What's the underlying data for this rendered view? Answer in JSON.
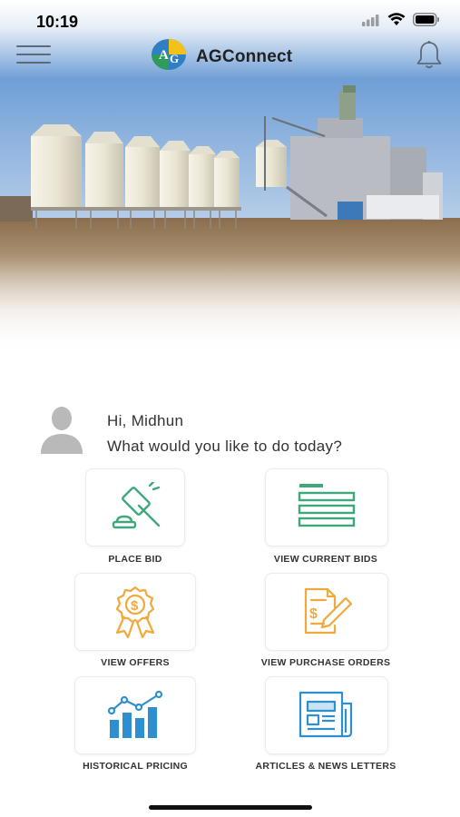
{
  "status": {
    "time": "10:19"
  },
  "header": {
    "app_title": "AGConnect",
    "logo_letters": "AG"
  },
  "greeting": {
    "hello": "Hi, Midhun",
    "prompt": "What would you like to do today?"
  },
  "actions": [
    {
      "label": "PLACE BID",
      "icon": "gavel-icon"
    },
    {
      "label": "VIEW CURRENT BIDS",
      "icon": "list-icon"
    },
    {
      "label": "VIEW OFFERS",
      "icon": "dollar-badge-icon"
    },
    {
      "label": "VIEW PURCHASE ORDERS",
      "icon": "document-pen-icon"
    },
    {
      "label": "HISTORICAL PRICING",
      "icon": "bar-chart-icon"
    },
    {
      "label": "ARTICLES & NEWS LETTERS",
      "icon": "newspaper-icon"
    }
  ],
  "colors": {
    "green": "#3fa87a",
    "orange": "#f0a93a",
    "blue": "#2d8fd0",
    "sky": "#4f86c6"
  }
}
